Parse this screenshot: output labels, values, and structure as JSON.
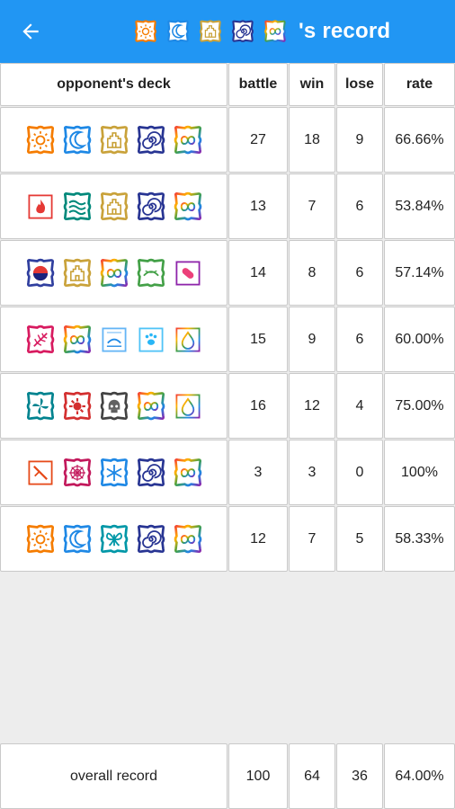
{
  "colors": {
    "appbar": "#2196f3",
    "background": "#ededed"
  },
  "header": {
    "title_suffix": "'s record",
    "deck_icons": [
      "sun",
      "moon",
      "castle",
      "spiral",
      "infinity"
    ]
  },
  "columns": [
    "opponent's deck",
    "battle",
    "win",
    "lose",
    "rate"
  ],
  "rows": [
    {
      "deck": [
        "sun",
        "moon",
        "castle",
        "spiral",
        "infinity"
      ],
      "battle": "27",
      "win": "18",
      "lose": "9",
      "rate": "66.66%"
    },
    {
      "deck": [
        "fire",
        "wave",
        "castle",
        "spiral",
        "infinity"
      ],
      "battle": "13",
      "win": "7",
      "lose": "6",
      "rate": "53.84%"
    },
    {
      "deck": [
        "yin-yang",
        "castle",
        "infinity",
        "leaf",
        "capsule"
      ],
      "battle": "14",
      "win": "8",
      "lose": "6",
      "rate": "57.14%"
    },
    {
      "deck": [
        "feather",
        "infinity",
        "book",
        "paw",
        "drop"
      ],
      "battle": "15",
      "win": "9",
      "lose": "6",
      "rate": "60.00%"
    },
    {
      "deck": [
        "pinwheel",
        "splat",
        "skull",
        "infinity",
        "drop"
      ],
      "battle": "16",
      "win": "12",
      "lose": "4",
      "rate": "75.00%"
    },
    {
      "deck": [
        "sword",
        "web",
        "snowflake",
        "spiral",
        "infinity"
      ],
      "battle": "3",
      "win": "3",
      "lose": "0",
      "rate": "100%"
    },
    {
      "deck": [
        "sun",
        "moon",
        "butterfly",
        "spiral",
        "infinity"
      ],
      "battle": "12",
      "win": "7",
      "lose": "5",
      "rate": "58.33%"
    }
  ],
  "overall": {
    "label": "overall record",
    "battle": "100",
    "win": "64",
    "lose": "36",
    "rate": "64.00%"
  }
}
